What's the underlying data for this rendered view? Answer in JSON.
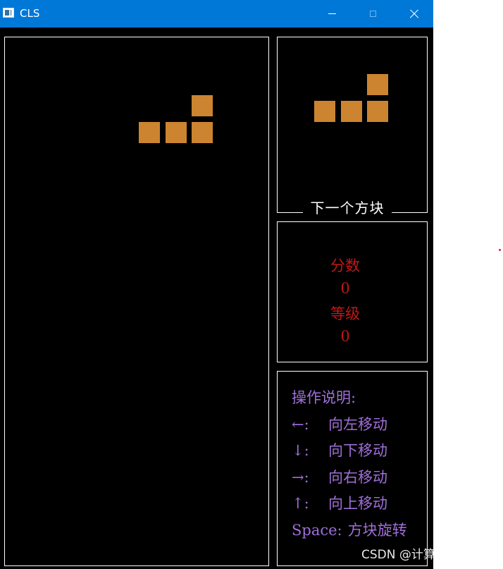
{
  "window": {
    "title": "CLS"
  },
  "icons": {
    "app": "app-window-icon",
    "minimize": "minimize-icon",
    "maximize": "maximize-icon",
    "close": "close-icon"
  },
  "colors": {
    "titlebar": "#0078d7",
    "background": "#000000",
    "block": "#cc8430",
    "score_text": "#c01818",
    "help_text": "#9f6fd8"
  },
  "board": {
    "falling_piece": {
      "shape": "L",
      "cells": [
        [
          2,
          0
        ],
        [
          0,
          1
        ],
        [
          1,
          1
        ],
        [
          2,
          1
        ]
      ]
    }
  },
  "next_piece": {
    "label": "下一个方块",
    "shape": "L",
    "cells": [
      [
        2,
        0
      ],
      [
        0,
        1
      ],
      [
        1,
        1
      ],
      [
        2,
        1
      ]
    ]
  },
  "score": {
    "score_label": "分数",
    "score_value": "0",
    "level_label": "等级",
    "level_value": "0"
  },
  "help": {
    "title": "操作说明:",
    "lines": [
      {
        "key": "←:",
        "action": "向左移动"
      },
      {
        "key": "↓:",
        "action": "向下移动"
      },
      {
        "key": "→:",
        "action": "向右移动"
      },
      {
        "key": "↑:",
        "action": "向上移动"
      },
      {
        "key": "Space:",
        "action": "方块旋转"
      }
    ]
  },
  "watermark": "CSDN @计算"
}
